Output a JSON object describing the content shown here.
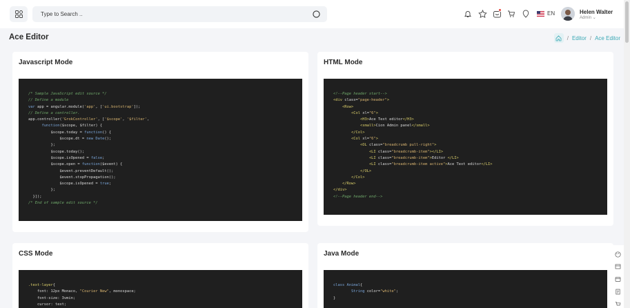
{
  "header": {
    "search_placeholder": "Type to Search ..",
    "language": "EN",
    "user": {
      "name": "Helen Walter",
      "role": "Admin"
    }
  },
  "page": {
    "title": "Ace Editor",
    "breadcrumb": [
      "Editor",
      "Ace Editor"
    ]
  },
  "cards": {
    "js": {
      "title": "Javascript Mode",
      "lines": [
        [
          [
            "c",
            "/* Sample JavaScript edit source */"
          ]
        ],
        [
          [
            "c",
            "// Define a module"
          ]
        ],
        [
          [
            "k",
            "var"
          ],
          [
            "t",
            " app = angular.module("
          ],
          [
            "s",
            "'app'"
          ],
          [
            "t",
            ", ["
          ],
          [
            "s",
            "'ui.bootstrap'"
          ],
          [
            "t",
            "]);"
          ]
        ],
        [
          [
            "c",
            "// Define a controller."
          ]
        ],
        [
          [
            "t",
            "app.controller("
          ],
          [
            "s",
            "'GrokController'"
          ],
          [
            "t",
            ", ["
          ],
          [
            "s",
            "'$scope'"
          ],
          [
            "t",
            ", "
          ],
          [
            "s",
            "'$filter'"
          ],
          [
            "t",
            ","
          ]
        ],
        [
          [
            "t",
            "      "
          ],
          [
            "k",
            "function"
          ],
          [
            "t",
            "($scope, $filter) {"
          ]
        ],
        [
          [
            "t",
            "          $scope.today = "
          ],
          [
            "k",
            "function"
          ],
          [
            "t",
            "() {"
          ]
        ],
        [
          [
            "t",
            "              $scope.dt = "
          ],
          [
            "k",
            "new"
          ],
          [
            "t",
            " "
          ],
          [
            "k",
            "Date"
          ],
          [
            "t",
            "();"
          ]
        ],
        [
          [
            "t",
            "          };"
          ]
        ],
        [
          [
            "t",
            "          $scope.today();"
          ]
        ],
        [
          [
            "t",
            "          $scope.isOpened = "
          ],
          [
            "k",
            "false"
          ],
          [
            "t",
            ";"
          ]
        ],
        [
          [
            "t",
            "          $scope.open = "
          ],
          [
            "k",
            "function"
          ],
          [
            "t",
            "($event) {"
          ]
        ],
        [
          [
            "t",
            "              $event.preventDefault();"
          ]
        ],
        [
          [
            "t",
            "              $event.stopPropagation();"
          ]
        ],
        [
          [
            "t",
            "              $scope.isOpened = "
          ],
          [
            "k",
            "true"
          ],
          [
            "t",
            ";"
          ]
        ],
        [
          [
            "t",
            "          };"
          ]
        ],
        [
          [
            "t",
            "  }]);"
          ]
        ],
        [
          [
            "c",
            "/* End of sample edit source */"
          ]
        ]
      ]
    },
    "html": {
      "title": "HTML Mode",
      "lines": [
        [
          [
            "c",
            "<!--Page header start-->"
          ]
        ],
        [
          [
            "tag",
            "<div"
          ],
          [
            "attr",
            " class="
          ],
          [
            "val",
            "\"page-header\""
          ],
          [
            "tag",
            ">"
          ]
        ],
        [
          [
            "t",
            "    "
          ],
          [
            "tag",
            "<Row>"
          ]
        ],
        [
          [
            "t",
            "        "
          ],
          [
            "tag",
            "<Col"
          ],
          [
            "attr",
            " xl="
          ],
          [
            "val",
            "\"6\""
          ],
          [
            "tag",
            ">"
          ]
        ],
        [
          [
            "t",
            "            "
          ],
          [
            "tag",
            "<H3>"
          ],
          [
            "t",
            "Ace Text editor"
          ],
          [
            "tag",
            "</H3>"
          ]
        ],
        [
          [
            "t",
            "            "
          ],
          [
            "tag",
            "<small>"
          ],
          [
            "t",
            "Cion Admin panel"
          ],
          [
            "tag",
            "</small>"
          ]
        ],
        [
          [
            "t",
            "        "
          ],
          [
            "tag",
            "</Col>"
          ]
        ],
        [
          [
            "t",
            "        "
          ],
          [
            "tag",
            "<Col"
          ],
          [
            "attr",
            " xl="
          ],
          [
            "val",
            "\"6\""
          ],
          [
            "tag",
            ">"
          ]
        ],
        [
          [
            "t",
            "            "
          ],
          [
            "tag",
            "<OL"
          ],
          [
            "attr",
            " class="
          ],
          [
            "val",
            "\"breadcrumb pull-right\""
          ],
          [
            "tag",
            ">"
          ]
        ],
        [
          [
            "t",
            "                "
          ],
          [
            "tag",
            "<LI"
          ],
          [
            "attr",
            " class="
          ],
          [
            "val",
            "\"breadcrumb-item\""
          ],
          [
            "tag",
            "></LI>"
          ]
        ],
        [
          [
            "t",
            "                "
          ],
          [
            "tag",
            "<LI"
          ],
          [
            "attr",
            " class="
          ],
          [
            "val",
            "\"breadcrumb-item\""
          ],
          [
            "tag",
            ">"
          ],
          [
            "t",
            "Editor "
          ],
          [
            "tag",
            "</LI>"
          ]
        ],
        [
          [
            "t",
            "                "
          ],
          [
            "tag",
            "<LI"
          ],
          [
            "attr",
            " class="
          ],
          [
            "val",
            "\"breadcrumb-item active\""
          ],
          [
            "tag",
            ">"
          ],
          [
            "t",
            "Ace Text editor"
          ],
          [
            "tag",
            "</LI>"
          ]
        ],
        [
          [
            "t",
            "            "
          ],
          [
            "tag",
            "</OL>"
          ]
        ],
        [
          [
            "t",
            "        "
          ],
          [
            "tag",
            "</Col>"
          ]
        ],
        [
          [
            "t",
            "    "
          ],
          [
            "tag",
            "</Row>"
          ]
        ],
        [
          [
            "tag",
            "</div>"
          ]
        ],
        [
          [
            "c",
            "<!--Page header end-->"
          ]
        ]
      ]
    },
    "css": {
      "title": "CSS Mode",
      "lines": [
        [
          [
            "tag",
            ".text-layer"
          ],
          [
            "t",
            "{"
          ]
        ],
        [
          [
            "t",
            "    font: 12px Monaco, "
          ],
          [
            "s",
            "\"Courier New\""
          ],
          [
            "t",
            ", monospace;"
          ]
        ],
        [
          [
            "t",
            "    font-size: 3vmin;"
          ]
        ],
        [
          [
            "t",
            "    cursor: text;"
          ]
        ]
      ]
    },
    "java": {
      "title": "Java Mode",
      "lines": [
        [
          [
            "k",
            "class"
          ],
          [
            "t",
            " "
          ],
          [
            "k",
            "Animal"
          ],
          [
            "t",
            "{"
          ]
        ],
        [
          [
            "t",
            "        "
          ],
          [
            "k",
            "String"
          ],
          [
            "t",
            " color="
          ],
          [
            "s",
            "\"white\""
          ],
          [
            "t",
            ";"
          ]
        ],
        [
          [
            "t",
            "}"
          ]
        ]
      ]
    }
  }
}
